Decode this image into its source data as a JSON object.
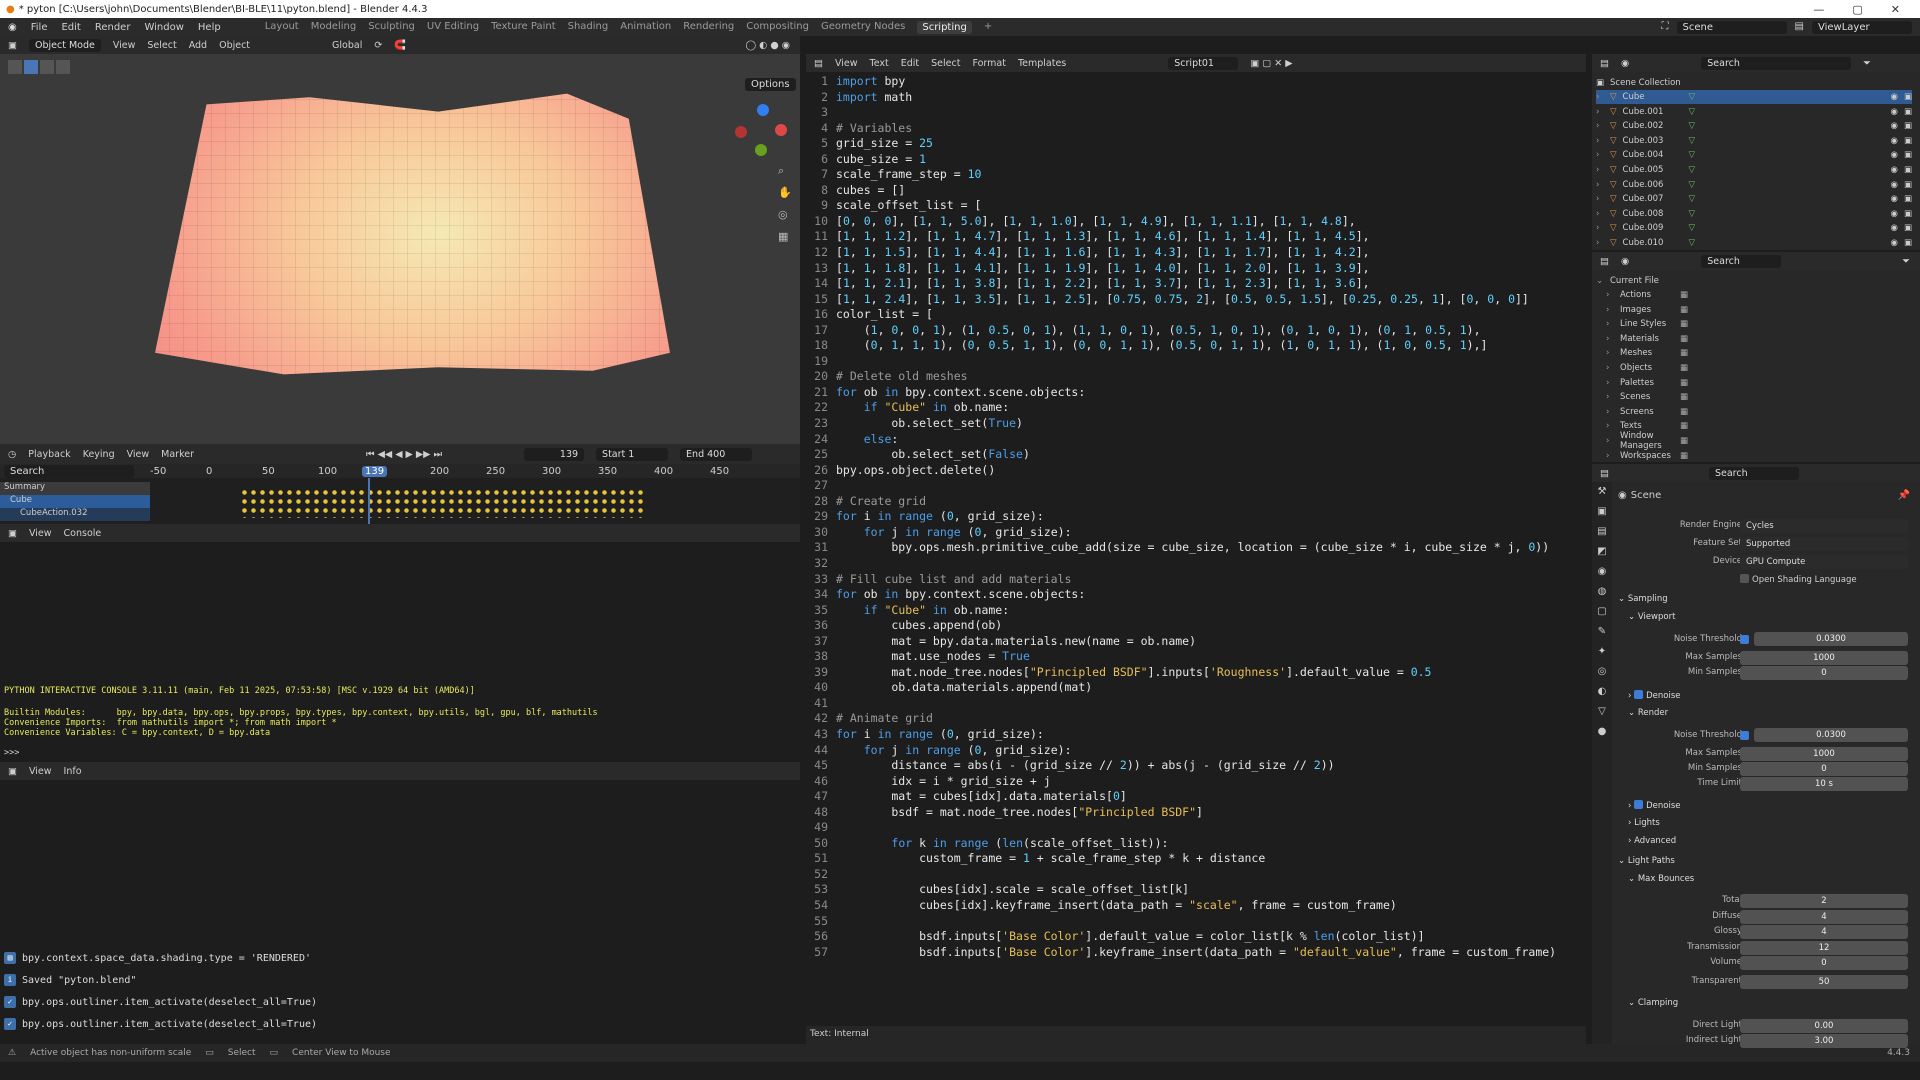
{
  "window": {
    "title": "* pyton [C:\\Users\\john\\Documents\\Blender\\BI-BLE\\11\\pyton.blend] - Blender 4.4.3"
  },
  "menu": [
    "File",
    "Edit",
    "Render",
    "Window",
    "Help"
  ],
  "workspaces": [
    "Layout",
    "Modeling",
    "Sculpting",
    "UV Editing",
    "Texture Paint",
    "Shading",
    "Animation",
    "Rendering",
    "Compositing",
    "Geometry Nodes",
    "Scripting"
  ],
  "scene_field": "Scene",
  "viewlayer_field": "ViewLayer",
  "viewport": {
    "mode": "Object Mode",
    "menus": [
      "View",
      "Select",
      "Add",
      "Object"
    ],
    "orientation": "Global",
    "options": "Options"
  },
  "timeline": {
    "menus": [
      "Playback",
      "Keying",
      "View",
      "Marker"
    ],
    "frame": "139",
    "start_label": "Start",
    "start": "1",
    "end_label": "End",
    "end": "400",
    "ticks": [
      "-50",
      "0",
      "50",
      "100",
      "139",
      "200",
      "250",
      "300",
      "350",
      "400",
      "450"
    ],
    "search": "Search",
    "rows": [
      "Summary",
      "Cube",
      "CubeAction.032"
    ]
  },
  "console": {
    "menus": [
      "View",
      "Console"
    ],
    "lines": [
      "PYTHON INTERACTIVE CONSOLE 3.11.11 (main, Feb 11 2025, 07:53:58) [MSC v.1929 64 bit (AMD64)]",
      "",
      "Builtin Modules:      bpy, bpy.data, bpy.ops, bpy.props, bpy.types, bpy.context, bpy.utils, bgl, gpu, blf, mathutils",
      "Convenience Imports:  from mathutils import *; from math import *",
      "Convenience Variables: C = bpy.context, D = bpy.data"
    ],
    "prompt": ">>> "
  },
  "info": {
    "menus": [
      "View",
      "Info"
    ],
    "lines": [
      "bpy.context.space_data.shading.type = 'RENDERED'",
      "Saved \"pyton.blend\"",
      "bpy.ops.outliner.item_activate(deselect_all=True)",
      "bpy.ops.outliner.item_activate(deselect_all=True)"
    ]
  },
  "status": [
    "Active object has non-uniform scale",
    "Select",
    "Center View to Mouse"
  ],
  "version": "4.4.3",
  "editor": {
    "menus": [
      "View",
      "Text",
      "Edit",
      "Select",
      "Format",
      "Templates"
    ],
    "script": "Script01",
    "footer": "Text: Internal",
    "code": [
      "import bpy",
      "import math",
      "",
      "# Variables",
      "grid_size = 25",
      "cube_size = 1",
      "scale_frame_step = 10",
      "cubes = []",
      "scale_offset_list = [",
      "[0, 0, 0], [1, 1, 5.0], [1, 1, 1.0], [1, 1, 4.9], [1, 1, 1.1], [1, 1, 4.8],",
      "[1, 1, 1.2], [1, 1, 4.7], [1, 1, 1.3], [1, 1, 4.6], [1, 1, 1.4], [1, 1, 4.5],",
      "[1, 1, 1.5], [1, 1, 4.4], [1, 1, 1.6], [1, 1, 4.3], [1, 1, 1.7], [1, 1, 4.2],",
      "[1, 1, 1.8], [1, 1, 4.1], [1, 1, 1.9], [1, 1, 4.0], [1, 1, 2.0], [1, 1, 3.9],",
      "[1, 1, 2.1], [1, 1, 3.8], [1, 1, 2.2], [1, 1, 3.7], [1, 1, 2.3], [1, 1, 3.6],",
      "[1, 1, 2.4], [1, 1, 3.5], [1, 1, 2.5], [0.75, 0.75, 2], [0.5, 0.5, 1.5], [0.25, 0.25, 1], [0, 0, 0]]",
      "color_list = [",
      "    (1, 0, 0, 1), (1, 0.5, 0, 1), (1, 1, 0, 1), (0.5, 1, 0, 1), (0, 1, 0, 1), (0, 1, 0.5, 1),",
      "    (0, 1, 1, 1), (0, 0.5, 1, 1), (0, 0, 1, 1), (0.5, 0, 1, 1), (1, 0, 1, 1), (1, 0, 0.5, 1),]",
      "",
      "# Delete old meshes",
      "for ob in bpy.context.scene.objects:",
      "    if \"Cube\" in ob.name:",
      "        ob.select_set(True)",
      "    else:",
      "        ob.select_set(False)",
      "bpy.ops.object.delete()",
      "",
      "# Create grid",
      "for i in range (0, grid_size):",
      "    for j in range (0, grid_size):",
      "        bpy.ops.mesh.primitive_cube_add(size = cube_size, location = (cube_size * i, cube_size * j, 0))",
      "",
      "# Fill cube list and add materials",
      "for ob in bpy.context.scene.objects:",
      "    if \"Cube\" in ob.name:",
      "        cubes.append(ob)",
      "        mat = bpy.data.materials.new(name = ob.name)",
      "        mat.use_nodes = True",
      "        mat.node_tree.nodes[\"Principled BSDF\"].inputs['Roughness'].default_value = 0.5",
      "        ob.data.materials.append(mat)",
      "",
      "# Animate grid",
      "for i in range (0, grid_size):",
      "    for j in range (0, grid_size):",
      "        distance = abs(i - (grid_size // 2)) + abs(j - (grid_size // 2))",
      "        idx = i * grid_size + j",
      "        mat = cubes[idx].data.materials[0]",
      "        bsdf = mat.node_tree.nodes[\"Principled BSDF\"]",
      "",
      "        for k in range (len(scale_offset_list)):",
      "            custom_frame = 1 + scale_frame_step * k + distance",
      "",
      "            cubes[idx].scale = scale_offset_list[k]",
      "            cubes[idx].keyframe_insert(data_path = \"scale\", frame = custom_frame)",
      "",
      "            bsdf.inputs['Base Color'].default_value = color_list[k % len(color_list)]",
      "            bsdf.inputs['Base Color'].keyframe_insert(data_path = \"default_value\", frame = custom_frame)"
    ]
  },
  "outliner": {
    "search": "Search",
    "collection": "Scene Collection",
    "objects": [
      "Cube",
      "Cube.001",
      "Cube.002",
      "Cube.003",
      "Cube.004",
      "Cube.005",
      "Cube.006",
      "Cube.007",
      "Cube.008",
      "Cube.009",
      "Cube.010"
    ]
  },
  "filebrowser": {
    "search": "Search",
    "root": "Current File",
    "items": [
      "Actions",
      "Images",
      "Line Styles",
      "Materials",
      "Meshes",
      "Objects",
      "Palettes",
      "Scenes",
      "Screens",
      "Texts",
      "Window Managers",
      "Workspaces"
    ]
  },
  "props": {
    "search": "Search",
    "scene": "Scene",
    "render_engine_label": "Render Engine",
    "render_engine": "Cycles",
    "feature_set_label": "Feature Set",
    "feature_set": "Supported",
    "device_label": "Device",
    "device": "GPU Compute",
    "osl": "Open Shading Language",
    "sampling": "Sampling",
    "viewport": "Viewport",
    "noise_label": "Noise Threshold",
    "vp_noise": "0.0300",
    "max_samples_label": "Max Samples",
    "vp_max": "1000",
    "min_samples_label": "Min Samples",
    "vp_min": "0",
    "denoise": "Denoise",
    "render": "Render",
    "r_noise": "0.0300",
    "r_max": "1000",
    "r_min": "0",
    "time_limit_label": "Time Limit",
    "r_time": "10 s",
    "lights": "Lights",
    "advanced": "Advanced",
    "light_paths": "Light Paths",
    "max_bounces": "Max Bounces",
    "bounces": [
      [
        "Total",
        "2"
      ],
      [
        "Diffuse",
        "4"
      ],
      [
        "Glossy",
        "4"
      ],
      [
        "Transmission",
        "12"
      ],
      [
        "Volume",
        "0"
      ]
    ],
    "transparent_label": "Transparent",
    "transparent": "50",
    "clamping": "Clamping",
    "direct_label": "Direct Light",
    "direct": "0.00",
    "indirect_label": "Indirect Light",
    "indirect": "3.00"
  }
}
